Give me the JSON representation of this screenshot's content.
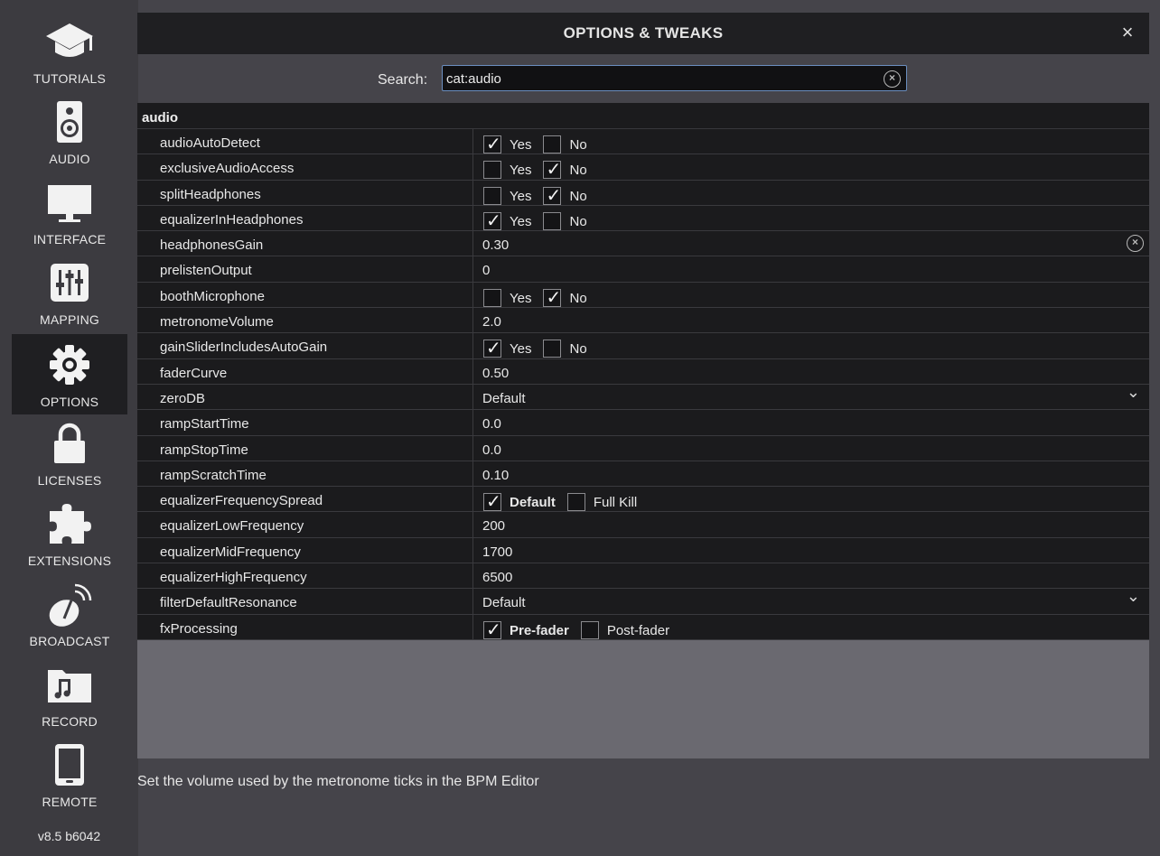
{
  "sidebar": {
    "items": [
      {
        "id": "tutorials",
        "label": "TUTORIALS",
        "icon": "graduation-cap-icon",
        "active": false
      },
      {
        "id": "audio",
        "label": "AUDIO",
        "icon": "speaker-icon",
        "active": false
      },
      {
        "id": "interface",
        "label": "INTERFACE",
        "icon": "monitor-icon",
        "active": false
      },
      {
        "id": "mapping",
        "label": "MAPPING",
        "icon": "sliders-icon",
        "active": false
      },
      {
        "id": "options",
        "label": "OPTIONS",
        "icon": "gear-icon",
        "active": true
      },
      {
        "id": "licenses",
        "label": "LICENSES",
        "icon": "lock-icon",
        "active": false
      },
      {
        "id": "extensions",
        "label": "EXTENSIONS",
        "icon": "puzzle-icon",
        "active": false
      },
      {
        "id": "broadcast",
        "label": "BROADCAST",
        "icon": "satellite-dish-icon",
        "active": false
      },
      {
        "id": "record",
        "label": "RECORD",
        "icon": "music-folder-icon",
        "active": false
      },
      {
        "id": "remote",
        "label": "REMOTE",
        "icon": "tablet-icon",
        "active": false
      }
    ],
    "version": "v8.5 b6042"
  },
  "header": {
    "title": "OPTIONS & TWEAKS",
    "close_label": "×"
  },
  "search": {
    "label": "Search:",
    "value": "cat:audio"
  },
  "table": {
    "group": "audio",
    "rows": [
      {
        "name": "audioAutoDetect",
        "type": "bool",
        "options": [
          "Yes",
          "No"
        ],
        "selected": 0
      },
      {
        "name": "exclusiveAudioAccess",
        "type": "bool",
        "options": [
          "Yes",
          "No"
        ],
        "selected": 1
      },
      {
        "name": "splitHeadphones",
        "type": "bool",
        "options": [
          "Yes",
          "No"
        ],
        "selected": 1
      },
      {
        "name": "equalizerInHeadphones",
        "type": "bool",
        "options": [
          "Yes",
          "No"
        ],
        "selected": 0
      },
      {
        "name": "headphonesGain",
        "type": "text",
        "value": "0.30",
        "clearable": true
      },
      {
        "name": "prelistenOutput",
        "type": "text",
        "value": "0"
      },
      {
        "name": "boothMicrophone",
        "type": "bool",
        "options": [
          "Yes",
          "No"
        ],
        "selected": 1
      },
      {
        "name": "metronomeVolume",
        "type": "text",
        "value": "2.0"
      },
      {
        "name": "gainSliderIncludesAutoGain",
        "type": "bool",
        "options": [
          "Yes",
          "No"
        ],
        "selected": 0
      },
      {
        "name": "faderCurve",
        "type": "text",
        "value": "0.50"
      },
      {
        "name": "zeroDB",
        "type": "select",
        "value": "Default"
      },
      {
        "name": "rampStartTime",
        "type": "text",
        "value": "0.0"
      },
      {
        "name": "rampStopTime",
        "type": "text",
        "value": "0.0"
      },
      {
        "name": "rampScratchTime",
        "type": "text",
        "value": "0.10"
      },
      {
        "name": "equalizerFrequencySpread",
        "type": "bool",
        "options": [
          "Default",
          "Full Kill"
        ],
        "selected": 0
      },
      {
        "name": "equalizerLowFrequency",
        "type": "text",
        "value": "200"
      },
      {
        "name": "equalizerMidFrequency",
        "type": "text",
        "value": "1700"
      },
      {
        "name": "equalizerHighFrequency",
        "type": "text",
        "value": "6500"
      },
      {
        "name": "filterDefaultResonance",
        "type": "select",
        "value": "Default"
      },
      {
        "name": "fxProcessing",
        "type": "bool",
        "options": [
          "Pre-fader",
          "Post-fader"
        ],
        "selected": 0
      }
    ]
  },
  "status_text": "Set the volume used by the metronome ticks in the BPM Editor"
}
